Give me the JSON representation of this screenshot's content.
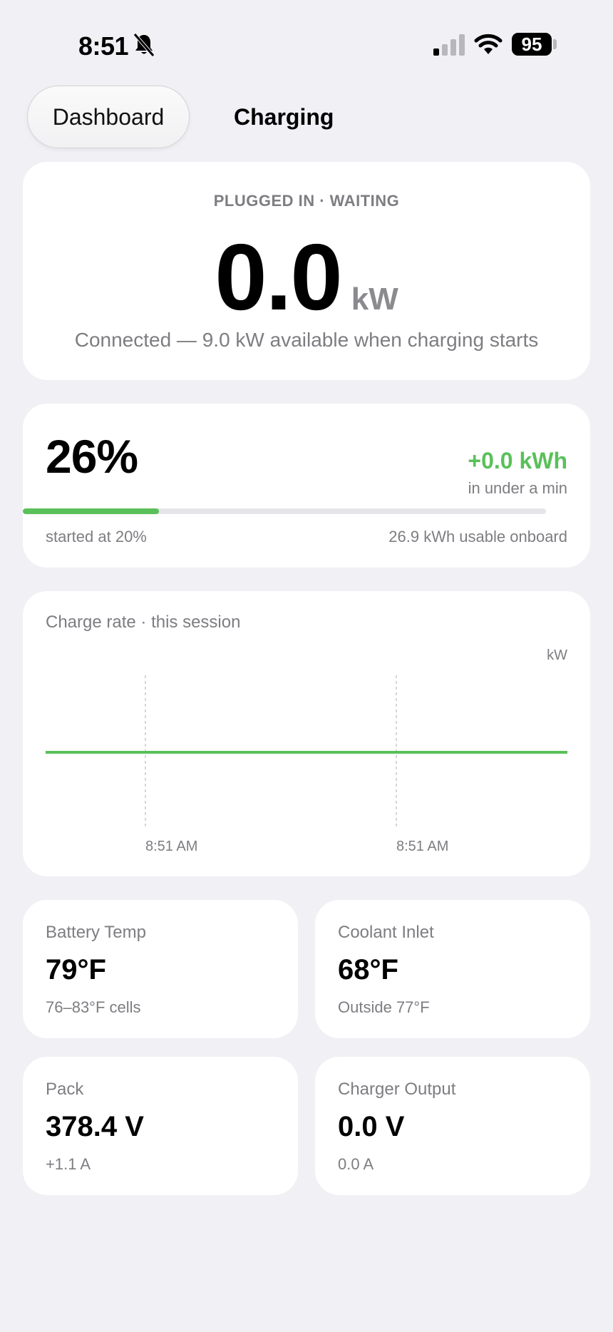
{
  "status_bar": {
    "time": "8:51",
    "battery_level": "95",
    "icons": [
      "bell-slash-icon",
      "cellular-signal-icon",
      "wifi-icon",
      "battery-icon"
    ]
  },
  "tabs": [
    {
      "label": "Dashboard"
    },
    {
      "label": "Charging"
    }
  ],
  "hero": {
    "status": "PLUGGED IN · WAITING",
    "power_value": "0.0",
    "power_unit": "kW",
    "subtitle": "Connected — 9.0 kW available when charging starts"
  },
  "soc": {
    "percent_label": "26%",
    "percent": 26,
    "added": "+0.0 kWh",
    "added_duration": "in under a min",
    "started_label": "started at 20%",
    "usable_label": "26.9 kWh usable onboard"
  },
  "chart": {
    "title": "Charge rate · this session",
    "unit_label": "kW",
    "time_labels": [
      "8:51 AM",
      "8:51 AM"
    ]
  },
  "tiles": [
    {
      "label": "Battery Temp",
      "value": "79°F",
      "sub": "76–83°F cells"
    },
    {
      "label": "Coolant Inlet",
      "value": "68°F",
      "sub": "Outside 77°F"
    },
    {
      "label": "Pack",
      "value": "378.4 V",
      "sub": "+1.1 A"
    },
    {
      "label": "Charger Output",
      "value": "0.0 V",
      "sub": "0.0 A"
    }
  ],
  "colors": {
    "accent_green": "#5ac05a",
    "background": "#f0f0f5",
    "secondary_text": "#7d7d82"
  }
}
